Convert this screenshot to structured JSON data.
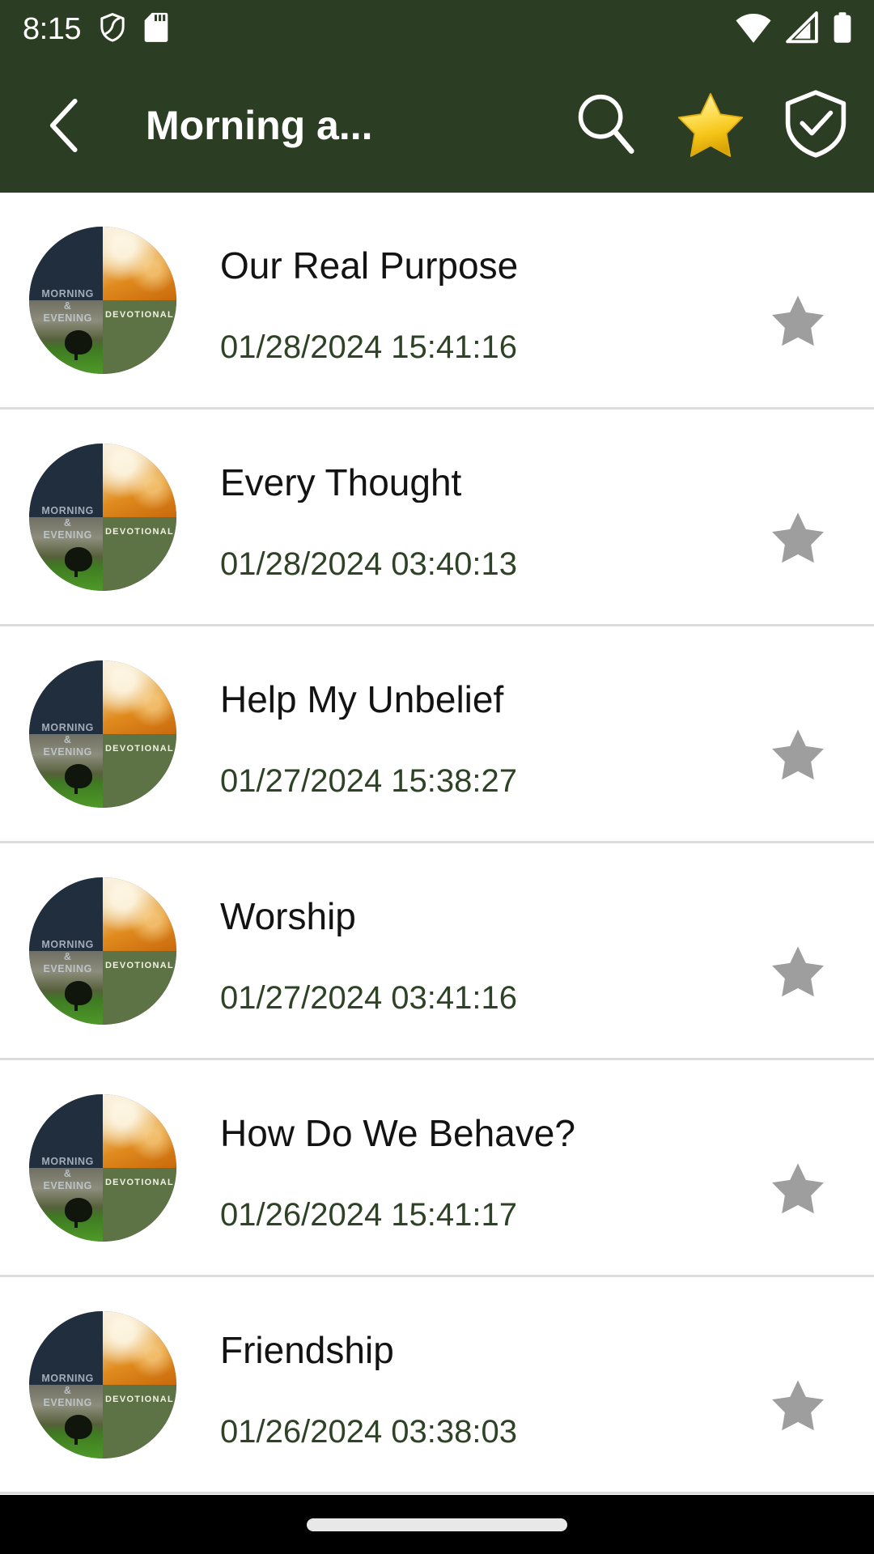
{
  "theme": {
    "toolbar_bg": "#2b3d22",
    "status_bg": "#2b3d22",
    "page_bg": "#ffffff",
    "title_color": "#ffffff",
    "item_title_color": "#131313",
    "item_date_color": "#2e4226",
    "star_active_color": "#f5c518",
    "star_inactive_color": "#9e9e9e",
    "divider_color": "#dcdcdc",
    "nav_bar_bg": "#000000"
  },
  "status_bar": {
    "time": "8:15",
    "left_icons": [
      {
        "name": "vpn-shield-icon",
        "label": "VPN active"
      },
      {
        "name": "sd-card-icon",
        "label": "SD card"
      }
    ],
    "right_icons": [
      {
        "name": "wifi-icon",
        "label": "Wi-Fi"
      },
      {
        "name": "cellular-signal-icon",
        "label": "Mobile signal"
      },
      {
        "name": "battery-icon",
        "label": "Battery full"
      }
    ]
  },
  "toolbar": {
    "back_label": "Back",
    "title": "Morning a...",
    "actions": [
      {
        "name": "search-icon",
        "label": "Search"
      },
      {
        "name": "favorite-star-icon",
        "label": "Favorites"
      },
      {
        "name": "shield-check-icon",
        "label": "Verified"
      }
    ]
  },
  "thumbnail": {
    "line1": "MORNING",
    "line2": "&",
    "line3": "EVENING",
    "line4": "DEVOTIONAL"
  },
  "list": {
    "items": [
      {
        "title": "Our Real Purpose",
        "date": "01/28/2024 15:41:16",
        "favorite": false
      },
      {
        "title": "Every Thought",
        "date": "01/28/2024 03:40:13",
        "favorite": false
      },
      {
        "title": "Help My Unbelief",
        "date": "01/27/2024 15:38:27",
        "favorite": false
      },
      {
        "title": "Worship",
        "date": "01/27/2024 03:41:16",
        "favorite": false
      },
      {
        "title": "How Do We Behave?",
        "date": "01/26/2024 15:41:17",
        "favorite": false
      },
      {
        "title": "Friendship",
        "date": "01/26/2024 03:38:03",
        "favorite": false
      }
    ]
  },
  "nav_bar": {
    "gesture_pill_label": "Home gesture bar"
  }
}
